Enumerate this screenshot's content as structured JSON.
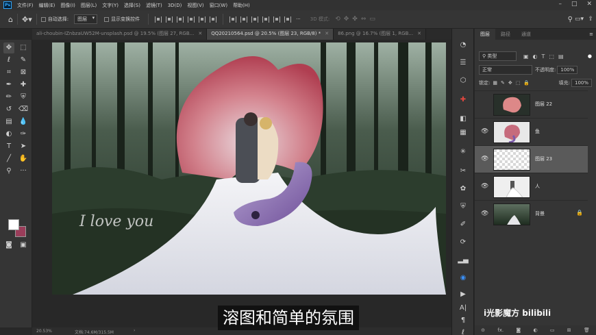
{
  "app": {
    "logo": "Ps"
  },
  "menubar": {
    "items": [
      "文件(F)",
      "编辑(E)",
      "图像(I)",
      "图层(L)",
      "文字(Y)",
      "选择(S)",
      "滤镜(T)",
      "3D(D)",
      "视图(V)",
      "窗口(W)",
      "帮助(H)"
    ]
  },
  "options_bar": {
    "auto_select_label": "自动选择:",
    "auto_select_value": "图层",
    "show_transform_label": "显示变换控件",
    "mode_3d_label": "3D 模式:"
  },
  "tabs": [
    {
      "label": "ali-choubin-IZnbzaUW52M-unsplash.psd @ 19.5% (图层 27, RGB...",
      "active": false
    },
    {
      "label": "QQ20210564.psd @ 20.5% (图层 23, RGB/8) *",
      "active": true
    },
    {
      "label": "86.png @ 16.7% (图层 1, RGB...",
      "active": false
    }
  ],
  "canvas": {
    "overlay_text": "I love you"
  },
  "status": {
    "zoom": "20.53%",
    "doc_size": "文档:74.6M/315.5M"
  },
  "layers_panel": {
    "tabs": [
      "图层",
      "路径",
      "通道"
    ],
    "filter_kind": "类型",
    "blend_mode": "正常",
    "opacity_label": "不透明度:",
    "opacity_value": "100%",
    "lock_label": "锁定:",
    "fill_label": "填充:",
    "fill_value": "100%",
    "layers": [
      {
        "name": "图层 22",
        "visible": false,
        "selected": false,
        "locked": false,
        "thumb": "fish-red"
      },
      {
        "name": "鱼",
        "visible": true,
        "selected": false,
        "locked": false,
        "thumb": "fish"
      },
      {
        "name": "图层 23",
        "visible": true,
        "selected": true,
        "locked": false,
        "thumb": "transparent"
      },
      {
        "name": "人",
        "visible": true,
        "selected": false,
        "locked": false,
        "thumb": "couple"
      },
      {
        "name": "背景",
        "visible": true,
        "selected": false,
        "locked": true,
        "thumb": "forest"
      }
    ],
    "footer_icons": [
      "link-icon",
      "fx-icon",
      "mask-icon",
      "adjustment-icon",
      "group-icon",
      "new-layer-icon",
      "trash-icon"
    ]
  },
  "subtitle": "溶图和简单的氛围",
  "watermark": "i光影魔方 bilibili",
  "colors": {
    "foreground": "#ffffff",
    "background": "#9a3d5a",
    "accent": "#31a8ff"
  }
}
